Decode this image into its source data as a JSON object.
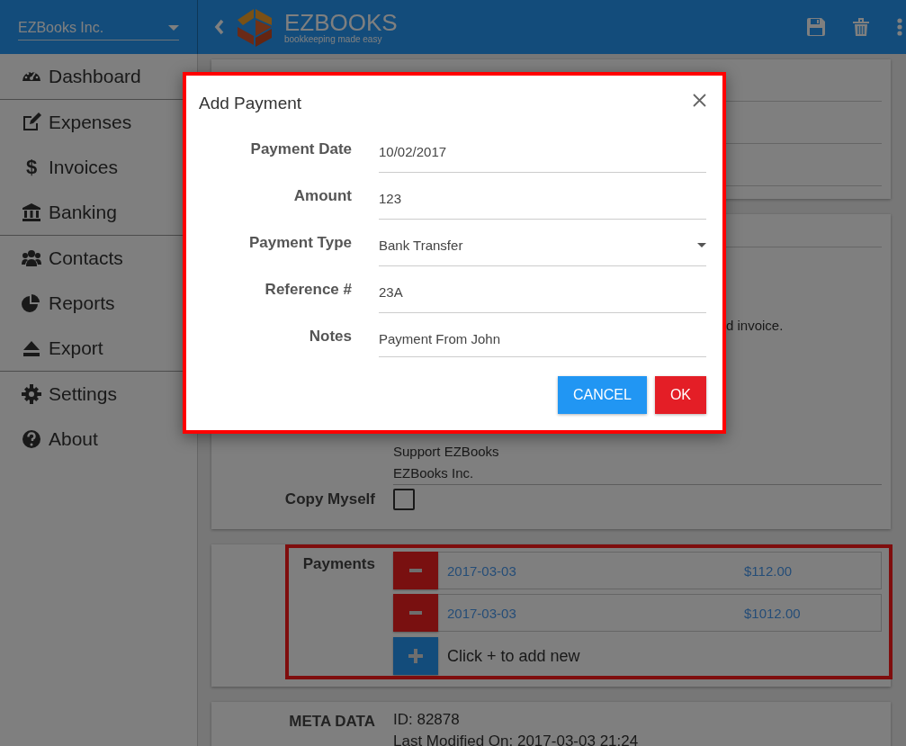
{
  "header": {
    "company": "EZBooks Inc.",
    "logo_name": "EZBOOKS",
    "logo_tagline": "bookkeeping made easy"
  },
  "sidebar": {
    "groups": [
      [
        {
          "label": "Dashboard",
          "kind": "gauge"
        }
      ],
      [
        {
          "label": "Expenses",
          "kind": "edit"
        },
        {
          "label": "Invoices",
          "kind": "glyph",
          "icon_text": "$"
        },
        {
          "label": "Banking",
          "kind": "bank"
        }
      ],
      [
        {
          "label": "Contacts",
          "kind": "people"
        },
        {
          "label": "Reports",
          "kind": "pie"
        },
        {
          "label": "Export",
          "kind": "eject"
        }
      ],
      [
        {
          "label": "Settings",
          "kind": "gear"
        },
        {
          "label": "About",
          "kind": "help"
        }
      ]
    ]
  },
  "form": {
    "note_fragment": "d invoice.",
    "recipients": [
      "Support EZBooks",
      "EZBooks Inc."
    ],
    "copy_myself": {
      "label": "Copy Myself",
      "checked": false
    }
  },
  "payments": {
    "label": "Payments",
    "highlighted": true,
    "rows": [
      {
        "date": "2017-03-03",
        "amount": "$112.00"
      },
      {
        "date": "2017-03-03",
        "amount": "$1012.00"
      }
    ],
    "add_hint": "Click + to add new"
  },
  "meta": {
    "label": "META DATA",
    "lines": [
      "ID: 82878",
      "Last Modified On: 2017-03-03 21:24"
    ]
  },
  "dialog": {
    "title": "Add Payment",
    "highlighted": true,
    "fields": [
      {
        "label": "Payment Date",
        "value": "10/02/2017",
        "kind": "text"
      },
      {
        "label": "Amount",
        "value": "123",
        "kind": "text"
      },
      {
        "label": "Payment Type",
        "value": "Bank Transfer",
        "kind": "select"
      },
      {
        "label": "Reference #",
        "value": "23A",
        "kind": "text"
      },
      {
        "label": "Notes",
        "value": "Payment From John",
        "kind": "text"
      }
    ],
    "buttons": [
      {
        "label": "CANCEL",
        "kind": "secondary"
      },
      {
        "label": "OK",
        "kind": "primary"
      }
    ]
  }
}
